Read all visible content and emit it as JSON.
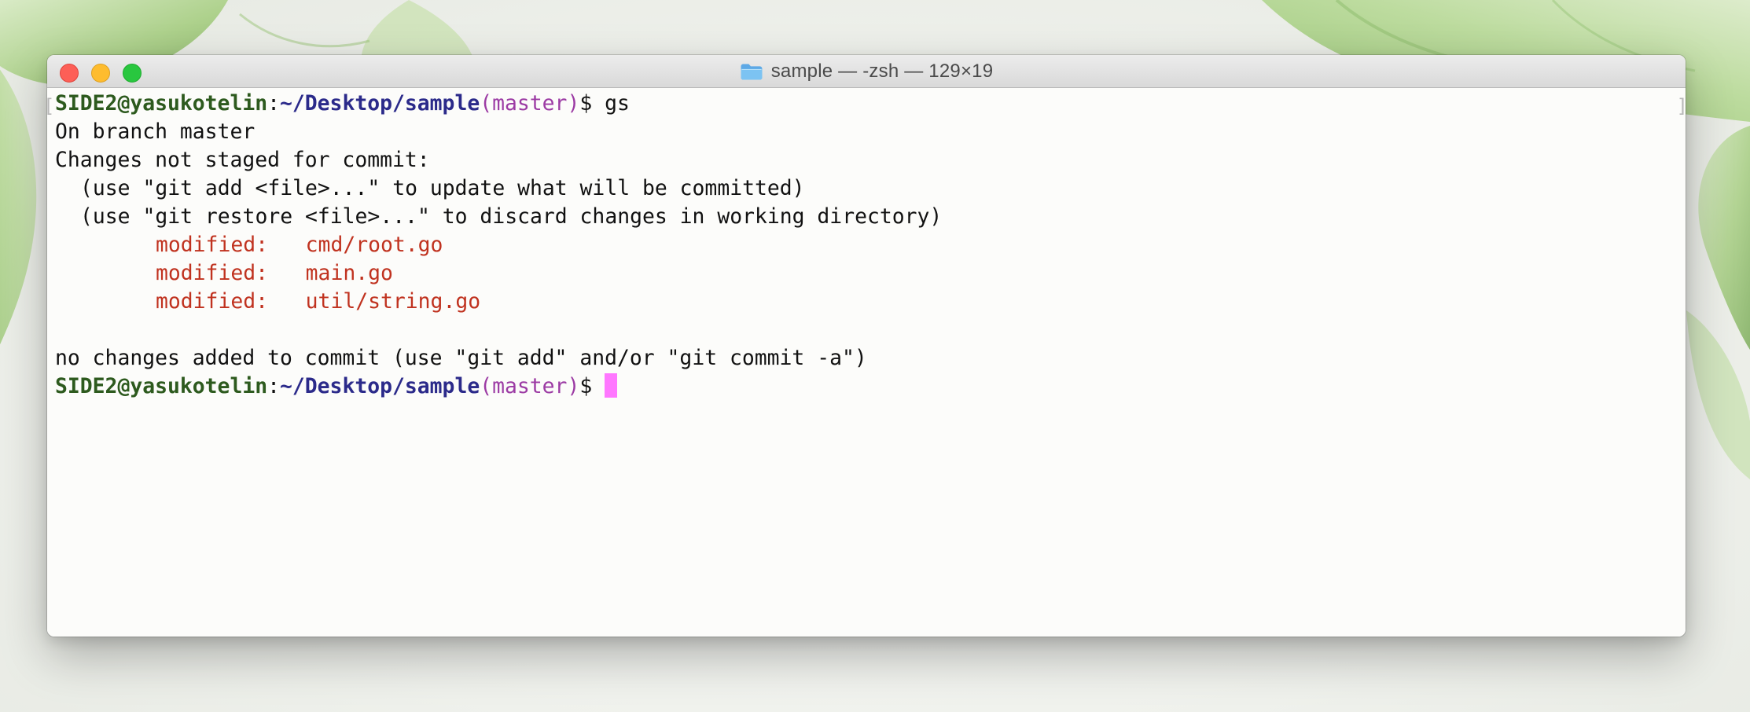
{
  "window": {
    "title": "sample — -zsh — 129×19"
  },
  "terminal": {
    "prompt": {
      "user_host": "SIDE2@yasukotelin",
      "separator": ":",
      "path": "~/Desktop/sample",
      "branch_open": "(",
      "branch": "master",
      "branch_close": ")",
      "symbol": "$"
    },
    "command": "gs",
    "output": {
      "line_branch": "On branch master",
      "line_header": "Changes not staged for commit:",
      "hint_add": "(use \"git add <file>...\" to update what will be committed)",
      "hint_restore": "(use \"git restore <file>...\" to discard changes in working directory)",
      "modified_files": [
        {
          "status": "modified:",
          "file": "cmd/root.go"
        },
        {
          "status": "modified:",
          "file": "main.go"
        },
        {
          "status": "modified:",
          "file": "util/string.go"
        }
      ],
      "summary": "no changes added to commit (use \"git add\" and/or \"git commit -a\")"
    }
  },
  "colors": {
    "user": "#2d5a1e",
    "path": "#2b2a8a",
    "branch": "#9c3ba4",
    "modified": "#c0321f",
    "cursor": "#ff77ff"
  },
  "icons": {
    "title_icon": "folder-icon",
    "window_controls": [
      "close-button",
      "minimize-button",
      "zoom-button"
    ]
  }
}
